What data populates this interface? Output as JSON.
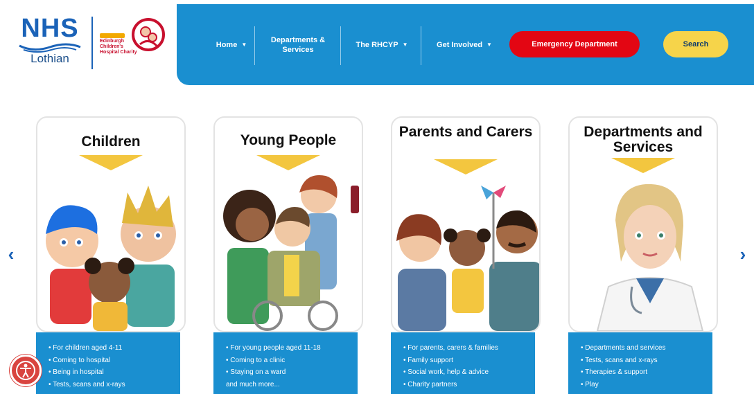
{
  "logo": {
    "nhs": "NHS",
    "region": "Lothian",
    "charity_lines": [
      "Edinburgh",
      "Children's",
      "Hospital Charity"
    ]
  },
  "nav": {
    "items": [
      {
        "label": "Home"
      },
      {
        "label": "Departments & Services"
      },
      {
        "label": "The RHCYP"
      },
      {
        "label": "Get Involved"
      }
    ],
    "emergency": "Emergency Department",
    "search": "Search"
  },
  "cards": [
    {
      "title": "Children",
      "bullets": [
        "• For children aged 4-11",
        "• Coming to hospital",
        "• Being in hospital",
        "• Tests, scans and x-rays"
      ]
    },
    {
      "title": "Young People",
      "bullets": [
        "• For young people aged 11-18",
        "• Coming to a clinic",
        "• Staying on a ward",
        "and much more..."
      ]
    },
    {
      "title": "Parents and Carers",
      "bullets": [
        "• For parents, carers & families",
        "• Family support",
        "• Social work, help & advice",
        "• Charity partners"
      ]
    },
    {
      "title": "Departments and Services",
      "bullets": [
        "• Departments and services",
        "• Tests, scans and x-rays",
        "• Therapies & support",
        "• Play"
      ]
    }
  ],
  "carousel": {
    "prev": "‹",
    "next": "›"
  },
  "colors": {
    "brand_blue": "#1a8fd0",
    "nhs_blue": "#1b63b8",
    "emergency_red": "#e30613",
    "search_yellow": "#f6d44a",
    "accent_yellow": "#f3c63f"
  },
  "icons": [
    "nhs-swirl-icon",
    "charity-logo-icon",
    "chevron-left-icon",
    "chevron-right-icon",
    "accessibility-icon"
  ]
}
